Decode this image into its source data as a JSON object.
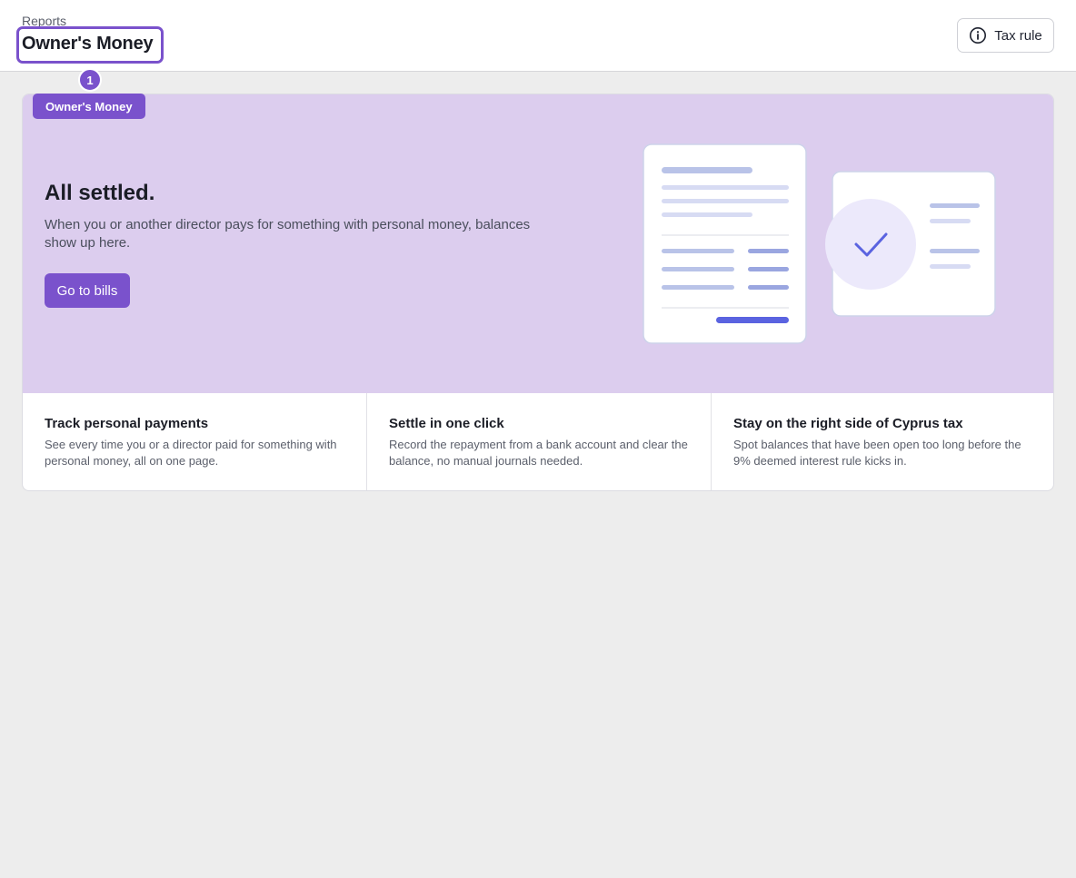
{
  "header": {
    "breadcrumb": "Reports",
    "title": "Owner's Money",
    "tax_button_label": "Tax rule",
    "tax_button_icon": "info-icon"
  },
  "annotation": {
    "step_number": "1",
    "tag_label": "Owner's Money"
  },
  "hero": {
    "title": "All settled.",
    "description": "When you or another director pays for something with personal money, balances show up here.",
    "button_label": "Go to bills",
    "illustration_icon": "check-icon"
  },
  "features": [
    {
      "title": "Track personal payments",
      "description": "See every time you or a director paid for something with personal money, all on one page."
    },
    {
      "title": "Settle in one click",
      "description": "Record the repayment from a bank account and clear the balance, no manual journals needed."
    },
    {
      "title": "Stay on the right side of Cyprus tax",
      "description": "Spot balances that have been open too long before the 9% deemed interest rule kicks in."
    }
  ],
  "colors": {
    "accent": "#7a52cc",
    "hero_background": "#dccdee",
    "page_background": "#ededed"
  }
}
